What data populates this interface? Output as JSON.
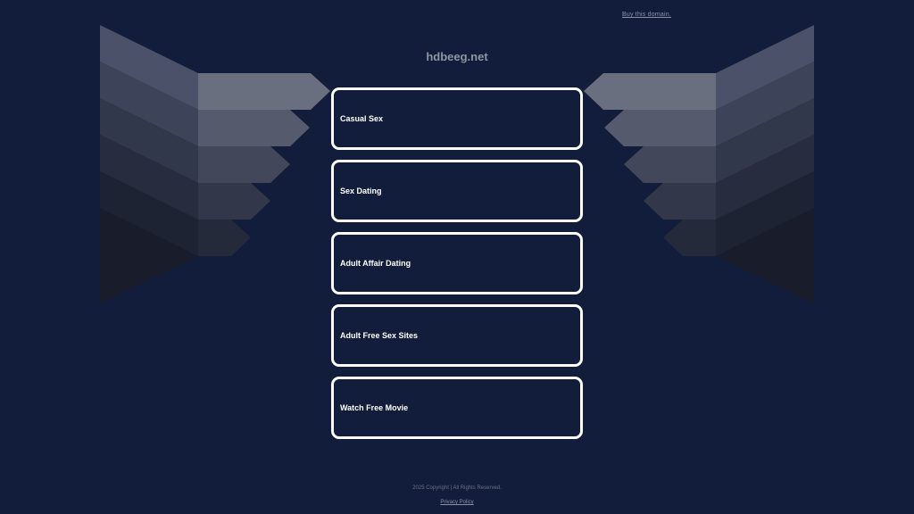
{
  "header": {
    "buy_domain": "Buy this domain."
  },
  "site": {
    "title": "hdbeeg.net"
  },
  "links": [
    {
      "label": "Casual Sex"
    },
    {
      "label": "Sex Dating"
    },
    {
      "label": "Adult Affair Dating"
    },
    {
      "label": "Adult Free Sex Sites"
    },
    {
      "label": "Watch Free Movie"
    }
  ],
  "footer": {
    "copyright": "2025 Copyright | All Rights Reserved.",
    "privacy": "Privacy Policy"
  },
  "colors": {
    "background": "#111d3a",
    "border": "#ffffff",
    "title": "#8e94a3"
  }
}
